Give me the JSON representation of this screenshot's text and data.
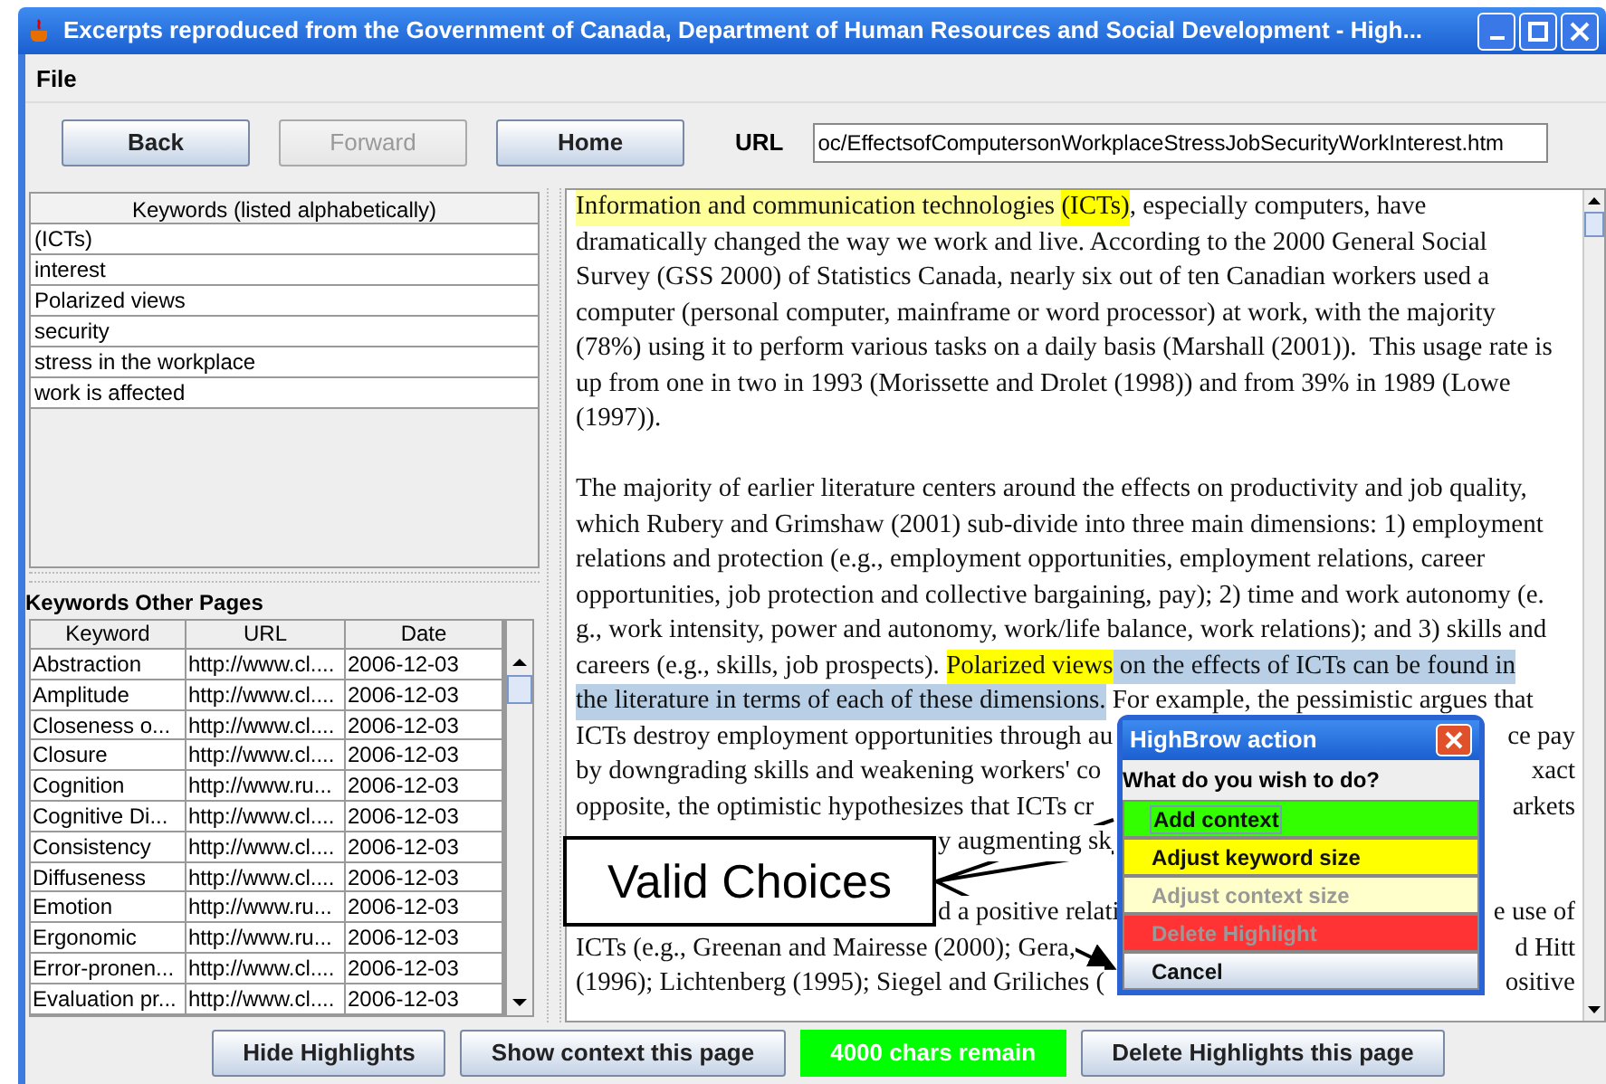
{
  "window": {
    "title": "Excerpts reproduced from the Government of Canada, Department of Human Resources and Social Development - High..."
  },
  "menu": [
    "File"
  ],
  "toolbar": {
    "buttons": [
      {
        "label": "Back",
        "disabled": false
      },
      {
        "label": "Forward",
        "disabled": true
      },
      {
        "label": "Home",
        "disabled": false
      }
    ],
    "url_label": "URL",
    "url": "oc/EffectsofComputersonWorkplaceStressJobSecurityWorkInterest.htm"
  },
  "keywords": {
    "header": "Keywords (listed alphabetically)",
    "items": [
      "(ICTs)",
      "interest",
      "Polarized views",
      "security",
      "stress in the workplace",
      "work is affected"
    ]
  },
  "other_pages": {
    "title": "Keywords Other Pages",
    "columns": [
      "Keyword",
      "URL",
      "Date"
    ],
    "rows": [
      [
        "Abstraction",
        "http://www.cl....",
        "2006-12-03"
      ],
      [
        "Amplitude",
        "http://www.cl....",
        "2006-12-03"
      ],
      [
        "Closeness o...",
        "http://www.cl....",
        "2006-12-03"
      ],
      [
        "Closure",
        "http://www.cl....",
        "2006-12-03"
      ],
      [
        "Cognition",
        "http://www.ru...",
        "2006-12-03"
      ],
      [
        "Cognitive Di...",
        "http://www.cl....",
        "2006-12-03"
      ],
      [
        "Consistency",
        "http://www.cl....",
        "2006-12-03"
      ],
      [
        "Diffuseness",
        "http://www.cl....",
        "2006-12-03"
      ],
      [
        "Emotion",
        "http://www.ru...",
        "2006-12-03"
      ],
      [
        "Ergonomic",
        "http://www.ru...",
        "2006-12-03"
      ],
      [
        "Error-pronen...",
        "http://www.cl....",
        "2006-12-03"
      ],
      [
        "Evaluation pr...",
        "http://www.cl....",
        "2006-12-03"
      ]
    ]
  },
  "document": {
    "paragraphs": [
      {
        "lines": [
          {
            "segments": [
              {
                "text": "Information and communication technologies ",
                "kind": "context"
              },
              {
                "text": "(ICTs)",
                "kind": "keyword"
              },
              {
                "text": ", especially computers, have",
                "kind": "plain"
              }
            ]
          },
          {
            "segments": [
              {
                "text": "dramatically changed the way we work and live. According to the 2000 General Social",
                "kind": "plain"
              }
            ]
          },
          {
            "segments": [
              {
                "text": "Survey (GSS 2000) of Statistics Canada, nearly six out of ten Canadian workers used a",
                "kind": "plain"
              }
            ]
          },
          {
            "segments": [
              {
                "text": "computer (personal computer, mainframe or word processor) at work, with the majority",
                "kind": "plain"
              }
            ]
          },
          {
            "segments": [
              {
                "text": "(78%) using it to perform various tasks on a daily basis (Marshall (2001)).  This usage rate is",
                "kind": "plain"
              }
            ]
          },
          {
            "segments": [
              {
                "text": "up from one in two in 1993 (Morissette and Drolet (1998)) and from 39% in 1989 (Lowe",
                "kind": "plain"
              }
            ]
          },
          {
            "segments": [
              {
                "text": "(1997)).",
                "kind": "plain"
              }
            ]
          }
        ]
      },
      {
        "lines": [
          {
            "segments": [
              {
                "text": "The majority of earlier literature centers around the effects on productivity and job quality,",
                "kind": "plain"
              }
            ]
          },
          {
            "segments": [
              {
                "text": "which Rubery and Grimshaw (2001) sub-divide into three main dimensions: 1) employment",
                "kind": "plain"
              }
            ]
          },
          {
            "segments": [
              {
                "text": "relations and protection (e.g., employment opportunities, employment relations, career",
                "kind": "plain"
              }
            ]
          },
          {
            "segments": [
              {
                "text": "opportunities, job protection and collective bargaining, pay); 2) time and work autonomy (e.",
                "kind": "plain"
              }
            ]
          },
          {
            "segments": [
              {
                "text": "g., work intensity, power and autonomy, work/life balance, work relations); and 3) skills and",
                "kind": "plain"
              }
            ]
          },
          {
            "segments": [
              {
                "text": "careers (e.g., skills, job prospects). ",
                "kind": "plain"
              },
              {
                "text": "Polarized views",
                "kind": "keyword"
              },
              {
                "text": " on the effects of ICTs can be found in",
                "kind": "selection"
              }
            ]
          },
          {
            "segments": [
              {
                "text": "the literature in terms of each of these dimensions.",
                "kind": "selection"
              },
              {
                "text": " For example, the pessimistic argues that",
                "kind": "plain"
              }
            ]
          },
          {
            "segments": [
              {
                "text": "ICTs destroy employment opportunities through au",
                "kind": "plain"
              }
            ],
            "right": "ce pay"
          },
          {
            "segments": [
              {
                "text": "by downgrading skills and weakening workers' co",
                "kind": "plain"
              }
            ],
            "right": "xact"
          },
          {
            "segments": [
              {
                "text": "opposite, the optimistic hypothesizes that ICTs cr",
                "kind": "plain"
              }
            ],
            "right": "arkets"
          },
          {
            "segments": [
              {
                "text": "y augmenting sk",
                "kind": "plain"
              }
            ],
            "covered_left": true
          }
        ]
      },
      {
        "lines": [
          {
            "segments": [
              {
                "text": "d a positive relati",
                "kind": "plain"
              }
            ],
            "covered_left": true,
            "right": "e use of"
          },
          {
            "segments": [
              {
                "text": "ICTs (e.g., Greenan and Mairesse (2000); Gera,",
                "kind": "plain"
              }
            ],
            "right": "d Hitt"
          },
          {
            "segments": [
              {
                "text": "(1996); Lichtenberg (1995); Siegel and Griliches (",
                "kind": "plain"
              }
            ],
            "right": "ositive"
          }
        ]
      }
    ]
  },
  "dialog": {
    "title": "HighBrow action",
    "question": "What do you wish to do?",
    "options": [
      {
        "label": "Add context",
        "kind": "green",
        "disabled": false,
        "focused": true
      },
      {
        "label": "Adjust keyword size",
        "kind": "yellow",
        "disabled": false,
        "focused": false
      },
      {
        "label": "Adjust context size",
        "kind": "pale",
        "disabled": true,
        "focused": false
      },
      {
        "label": "Delete Highlight",
        "kind": "red",
        "disabled": true,
        "focused": false
      },
      {
        "label": "Cancel",
        "kind": "plain",
        "disabled": false,
        "focused": false
      }
    ]
  },
  "callout": {
    "text": "Valid Choices"
  },
  "bottom": [
    {
      "label": "Hide Highlights",
      "kind": "button"
    },
    {
      "label": "Show context this page",
      "kind": "button"
    },
    {
      "label": "4000 chars remain",
      "kind": "status"
    },
    {
      "label": "Delete Highlights this page",
      "kind": "button"
    }
  ]
}
